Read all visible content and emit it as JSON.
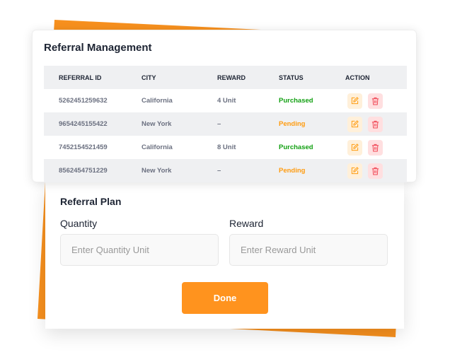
{
  "colors": {
    "accent": "#ff931e",
    "purchased": "#12a012",
    "pending": "#ff9b0f",
    "edit_bg": "#fff0da",
    "delete_bg": "#ffdfe0"
  },
  "management": {
    "title": "Referral  Management",
    "columns": [
      "REFERRAL ID",
      "CITY",
      "REWARD",
      "STATUS",
      "ACTION"
    ],
    "rows": [
      {
        "id": "5262451259632",
        "city": "California",
        "reward": "4 Unit",
        "status": "Purchased"
      },
      {
        "id": "9654245155422",
        "city": "New York",
        "reward": "–",
        "status": "Pending"
      },
      {
        "id": "7452154521459",
        "city": "California",
        "reward": "8 Unit",
        "status": "Purchased"
      },
      {
        "id": "8562454751229",
        "city": "New York",
        "reward": "–",
        "status": "Pending"
      }
    ],
    "icons": {
      "edit": "edit-icon",
      "delete": "trash-icon"
    }
  },
  "plan": {
    "title": "Referral Plan",
    "quantity_label": "Quantity",
    "quantity_placeholder": "Enter Quantity Unit",
    "reward_label": "Reward",
    "reward_placeholder": "Enter Reward Unit",
    "done_label": "Done"
  }
}
